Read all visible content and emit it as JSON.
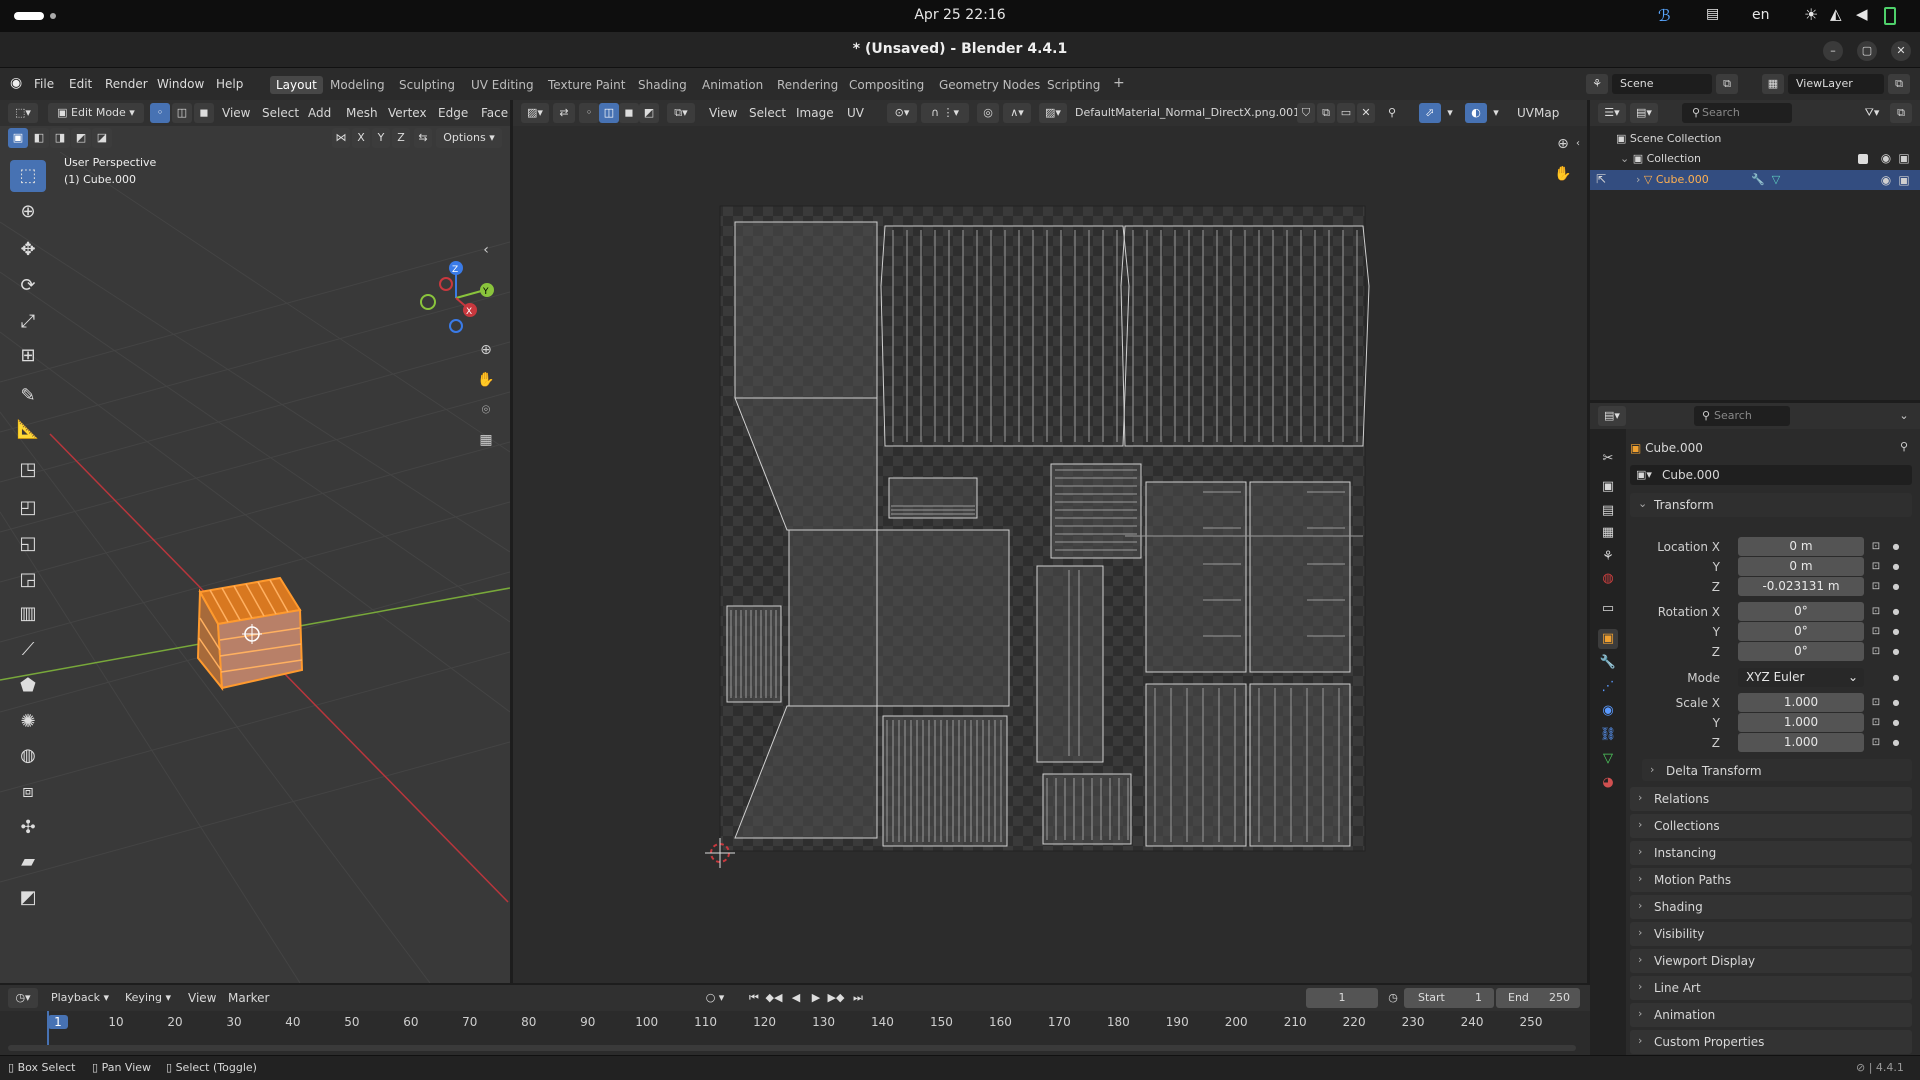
{
  "system": {
    "date": "Apr 25  22:16",
    "lang": "en"
  },
  "window": {
    "title": "* (Unsaved) - Blender 4.4.1",
    "min": "–",
    "max": "▢",
    "close": "✕"
  },
  "menu": [
    "File",
    "Edit",
    "Render",
    "Window",
    "Help"
  ],
  "workspaces": [
    "Layout",
    "Modeling",
    "Sculpting",
    "UV Editing",
    "Texture Paint",
    "Shading",
    "Animation",
    "Rendering",
    "Compositing",
    "Geometry Nodes",
    "Scripting"
  ],
  "add_ws": "+",
  "scene": {
    "name": "Scene",
    "viewlayer": "ViewLayer"
  },
  "viewport": {
    "mode": "Edit Mode",
    "menus": [
      "View",
      "Select",
      "Add",
      "Mesh",
      "Vertex",
      "Edge",
      "Face"
    ],
    "options": "Options",
    "axes": [
      "X",
      "Y",
      "Z"
    ],
    "overlay_title": "User Perspective",
    "overlay_obj": "(1) Cube.000",
    "gizmo": {
      "z": "Z",
      "y": "Y",
      "x": "X"
    }
  },
  "uv": {
    "menus": [
      "View",
      "Select",
      "Image",
      "UV"
    ],
    "image": "DefaultMaterial_Normal_DirectX.png.001",
    "uvmap": "UVMap"
  },
  "outliner": {
    "search": "Search",
    "root": "Scene Collection",
    "collection": "Collection",
    "object": "Cube.000"
  },
  "properties": {
    "search": "Search",
    "object": "Cube.000",
    "datablock": "Cube.000",
    "transform": "Transform",
    "location": {
      "label": "Location X",
      "x": "0 m",
      "y": "0 m",
      "z": "-0.023131 m"
    },
    "rotation": {
      "label": "Rotation X",
      "x": "0°",
      "y": "0°",
      "z": "0°"
    },
    "mode_label": "Mode",
    "mode": "XYZ Euler",
    "scale": {
      "label": "Scale X",
      "x": "1.000",
      "y": "1.000",
      "z": "1.000"
    },
    "y": "Y",
    "z": "Z",
    "delta": "Delta Transform",
    "panels": [
      "Relations",
      "Collections",
      "Instancing",
      "Motion Paths",
      "Shading",
      "Visibility",
      "Viewport Display",
      "Line Art",
      "Animation",
      "Custom Properties"
    ]
  },
  "timeline": {
    "menus": [
      "Playback",
      "Keying",
      "View",
      "Marker"
    ],
    "current": "1",
    "start_label": "Start",
    "start": "1",
    "end_label": "End",
    "end": "250",
    "ticks": [
      "1",
      "10",
      "20",
      "30",
      "40",
      "50",
      "60",
      "70",
      "80",
      "90",
      "100",
      "110",
      "120",
      "130",
      "140",
      "150",
      "160",
      "170",
      "180",
      "190",
      "200",
      "210",
      "220",
      "230",
      "240",
      "250"
    ]
  },
  "status": {
    "items": [
      "Box Select",
      "Pan View",
      "Select (Toggle)"
    ],
    "version": "4.4.1"
  },
  "colors": {
    "accent": "#4772b3",
    "select": "#ff8a1e",
    "x_axis": "#c8383e",
    "y_axis": "#8ac43c",
    "z_axis": "#3a7be8"
  }
}
